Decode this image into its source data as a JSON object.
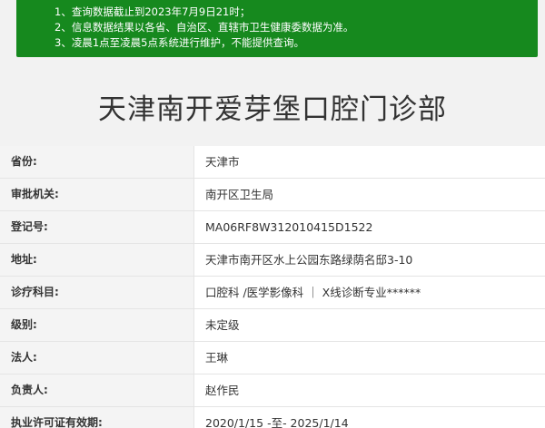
{
  "notice": {
    "lines": [
      "1、查询数据截止到2023年7月9日21时；",
      "2、信息数据结果以各省、自治区、直辖市卫生健康委数据为准。",
      "3、凌晨1点至凌晨5点系统进行维护，不能提供查询。"
    ],
    "background_color": "#16891e"
  },
  "title": "天津南开爱芽堡口腔门诊部",
  "rows": [
    {
      "label": "省份:",
      "value": "天津市"
    },
    {
      "label": "审批机关:",
      "value": "南开区卫生局"
    },
    {
      "label": "登记号:",
      "value": "MA06RF8W312010415D1522"
    },
    {
      "label": "地址:",
      "value": "天津市南开区水上公园东路绿荫名邸3-10"
    },
    {
      "label": "诊疗科目:",
      "value": "口腔科 /医学影像科 ｜ X线诊断专业******"
    },
    {
      "label": "级别:",
      "value": "未定级"
    },
    {
      "label": "法人:",
      "value": "王琳"
    },
    {
      "label": "负责人:",
      "value": "赵作民"
    },
    {
      "label": "执业许可证有效期:",
      "value": "2020/1/15 -至- 2025/1/14"
    }
  ]
}
